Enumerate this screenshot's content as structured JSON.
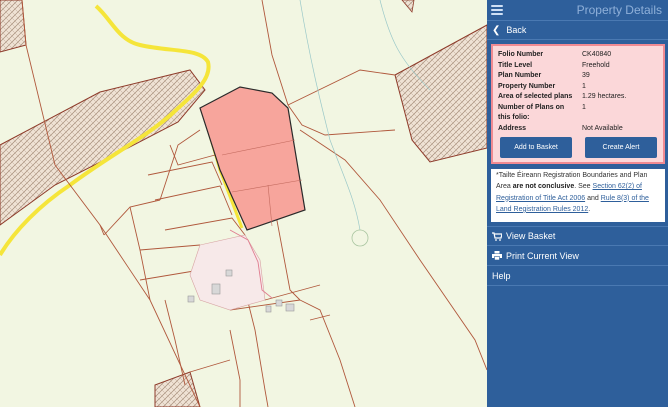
{
  "map": {
    "selected_parcel_color": "#f7a59c",
    "parcel_line_color": "#b0583c",
    "road_color": "#f5e53a"
  },
  "panel": {
    "title": "Property Details",
    "back_label": "Back",
    "details": [
      {
        "label": "Folio Number",
        "value": "CK40840"
      },
      {
        "label": "Title Level",
        "value": "Freehold"
      },
      {
        "label": "Plan Number",
        "value": "39"
      },
      {
        "label": "Property Number",
        "value": "1"
      },
      {
        "label": "Area of selected plans",
        "value": "1.29 hectares."
      },
      {
        "label": "Number of Plans on this folio:",
        "value": "1"
      },
      {
        "label": "Address",
        "value": "Not Available"
      }
    ],
    "add_to_basket_label": "Add to Basket",
    "create_alert_label": "Create Alert",
    "disclaimer": {
      "prefix": "*Tailte Éireann Registration Boundaries and Plan Area",
      "bold": "are not conclusive",
      "see": ". See",
      "link1": "Section 62(2) of Registration of Title Act 2006",
      "and": "and",
      "link2": "Rule 8(3) of the Land Registration Rules 2012",
      "suffix": "."
    },
    "menu": {
      "view_basket": "View Basket",
      "print_view": "Print Current View",
      "help": "Help"
    },
    "accent_color": "#2e5f9b",
    "details_bg": "#fbd7d9"
  }
}
